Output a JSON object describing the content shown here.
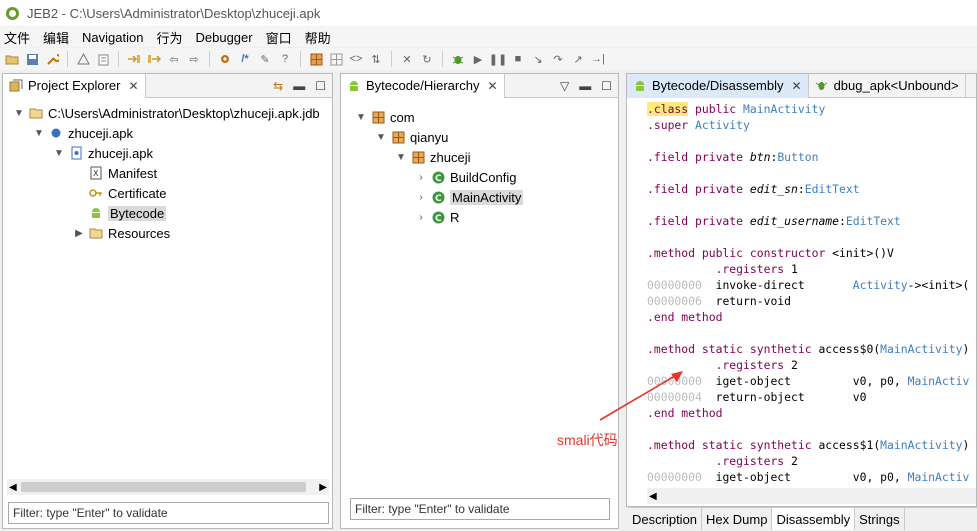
{
  "window": {
    "title": "JEB2 - C:\\Users\\Administrator\\Desktop\\zhuceji.apk"
  },
  "menu": [
    "文件",
    "编辑",
    "Navigation",
    "行为",
    "Debugger",
    "窗口",
    "帮助"
  ],
  "project_explorer": {
    "tab_label": "Project Explorer",
    "tree": [
      {
        "label": "C:\\Users\\Administrator\\Desktop\\zhuceji.apk.jdb",
        "icon": "folder-icon"
      },
      {
        "label": "zhuceji.apk",
        "icon": "artifact-icon"
      },
      {
        "label": "zhuceji.apk",
        "icon": "apk-icon"
      },
      {
        "label": "Manifest",
        "icon": "xml-icon"
      },
      {
        "label": "Certificate",
        "icon": "key-icon"
      },
      {
        "label": "Bytecode",
        "icon": "android-icon"
      },
      {
        "label": "Resources",
        "icon": "folder-icon"
      }
    ],
    "filter_placeholder": "Filter: type \"Enter\" to validate"
  },
  "hierarchy": {
    "tab_label": "Bytecode/Hierarchy",
    "tree": [
      {
        "label": "com",
        "icon": "package-icon"
      },
      {
        "label": "qianyu",
        "icon": "package-icon"
      },
      {
        "label": "zhuceji",
        "icon": "package-icon"
      },
      {
        "label": "BuildConfig",
        "icon": "class-icon"
      },
      {
        "label": "MainActivity",
        "icon": "class-icon"
      },
      {
        "label": "R",
        "icon": "class-icon"
      }
    ],
    "filter_placeholder": "Filter: type \"Enter\" to validate"
  },
  "disassembly": {
    "tab_label": "Bytecode/Disassembly",
    "tab2_label": "dbug_apk<Unbound>",
    "lines": [
      ".class public MainActivity",
      ".super Activity",
      "",
      ".field private btn:Button",
      "",
      ".field private edit_sn:EditText",
      "",
      ".field private edit_username:EditText",
      "",
      ".method public constructor <init>()V",
      "          .registers 1",
      "00000000  invoke-direct       Activity-><init>(",
      "00000006  return-void",
      ".end method",
      "",
      ".method static synthetic access$0(MainActivity)",
      "          .registers 2",
      "00000000  iget-object         v0, p0, MainActiv",
      "00000004  return-object       v0",
      ".end method",
      "",
      ".method static synthetic access$1(MainActivity)",
      "          .registers 2",
      "00000000  iget-object         v0, p0, MainActiv"
    ],
    "bottom_tabs": [
      "Description",
      "Hex Dump",
      "Disassembly",
      "Strings"
    ],
    "active_bottom_tab": "Disassembly"
  },
  "annotation": {
    "label": "smali代码",
    "color": "#e8342a"
  }
}
